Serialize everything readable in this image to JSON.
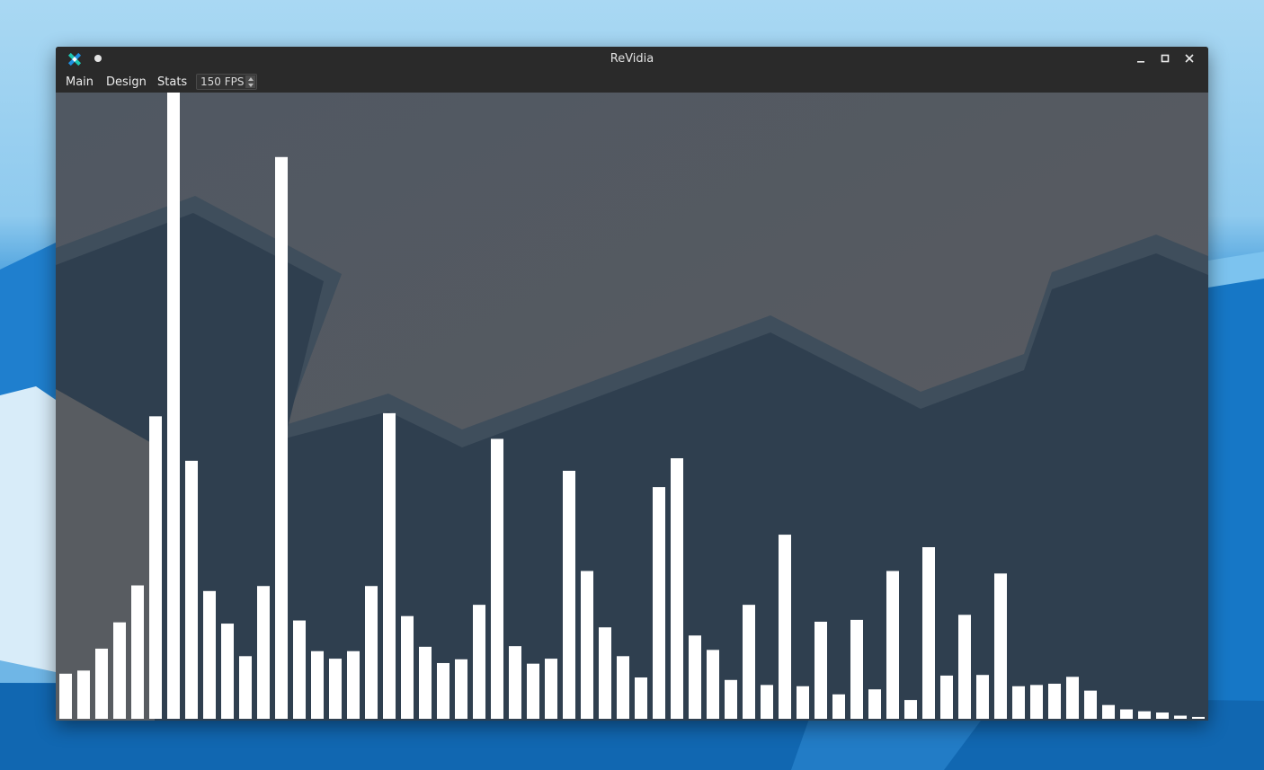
{
  "window": {
    "title": "ReVidia"
  },
  "menu": {
    "main": "Main",
    "design": "Design",
    "stats": "Stats",
    "fps_value": "150 FPS"
  },
  "icons": {
    "app": "revidia-logo-icon",
    "pin": "pin-dot-icon",
    "minimize": "minimize-icon",
    "maximize": "maximize-icon",
    "close": "close-icon",
    "spin_up": "spin-up-icon",
    "spin_down": "spin-down-icon"
  },
  "colors": {
    "bar": "#ffffff",
    "titlebar": "#2a2a2a",
    "accent_teal": "#1ec8b4",
    "accent_blue": "#1d8fe0"
  },
  "chart_data": {
    "type": "bar",
    "title": "",
    "xlabel": "",
    "ylabel": "",
    "ylim": [
      0,
      100
    ],
    "values": [
      7.2,
      7.7,
      11.2,
      15.4,
      21.3,
      48.3,
      100,
      41.2,
      20.4,
      15.2,
      10.0,
      21.2,
      89.7,
      15.7,
      10.8,
      9.6,
      10.8,
      21.2,
      48.8,
      16.4,
      11.5,
      8.9,
      9.5,
      18.2,
      44.7,
      11.6,
      8.8,
      9.6,
      39.6,
      23.6,
      14.6,
      10.0,
      6.6,
      37.0,
      41.6,
      13.3,
      11.0,
      6.2,
      18.2,
      5.4,
      29.4,
      5.2,
      15.5,
      3.9,
      15.8,
      4.7,
      23.6,
      3.0,
      27.4,
      6.9,
      16.6,
      7.0,
      23.2,
      5.2,
      5.4,
      5.6,
      6.7,
      4.5,
      2.2,
      1.5,
      1.2,
      1.0,
      0.5,
      0.3
    ]
  }
}
